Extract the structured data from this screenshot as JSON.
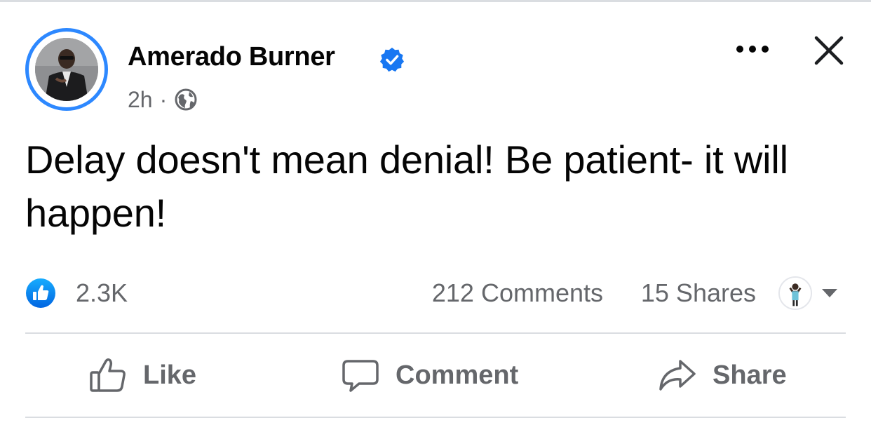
{
  "post": {
    "author": "Amerado Burner",
    "time": "2h",
    "separator": "·",
    "text": "Delay doesn't mean denial! Be patient- it will happen!"
  },
  "icons": {
    "verified": "verified-badge-icon",
    "audience": "globe-icon",
    "more": "more-options-icon",
    "close": "close-icon",
    "reaction": "like-reaction-icon",
    "dropdown": "caret-down-icon",
    "like": "thumbs-up-icon",
    "comment": "speech-bubble-icon",
    "share": "share-arrow-icon"
  },
  "stats": {
    "likes": "2.3K",
    "comments": "212 Comments",
    "shares": "15 Shares"
  },
  "actions": {
    "like": "Like",
    "comment": "Comment",
    "share": "Share"
  },
  "colors": {
    "accent": "#1877f2",
    "ring": "#2d88ff",
    "secondary_text": "#65676b",
    "primary_text": "#050505",
    "divider": "#dadde1"
  }
}
